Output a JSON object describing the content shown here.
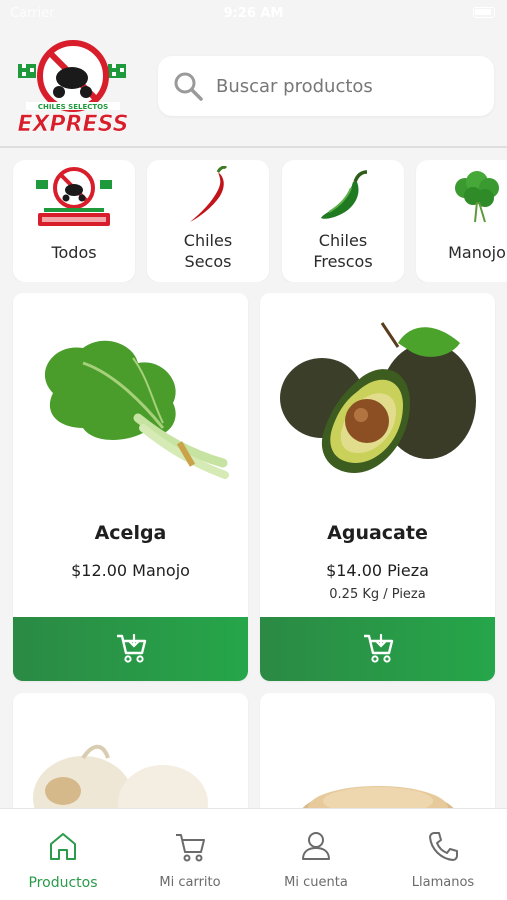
{
  "status_bar": {
    "carrier": "Carrier",
    "time": "9:26 AM"
  },
  "header": {
    "brand_line1": "CHILES SELECTOS",
    "brand_line2": "EXPRESS",
    "search_placeholder": "Buscar productos"
  },
  "categories": [
    {
      "label": "Todos",
      "icon": "brand-logo-icon"
    },
    {
      "label_line1": "Chiles",
      "label_line2": "Secos",
      "icon": "red-chili-icon"
    },
    {
      "label_line1": "Chiles",
      "label_line2": "Frescos",
      "icon": "green-chili-icon"
    },
    {
      "label": "Manojo",
      "icon": "parsley-icon"
    }
  ],
  "products": [
    {
      "name": "Acelga",
      "price": "$12.00 Manojo",
      "icon": "chard-icon"
    },
    {
      "name": "Aguacate",
      "price": "$14.00 Pieza",
      "weight": "0.25 Kg / Pieza",
      "icon": "avocado-icon"
    },
    {
      "icon": "garlic-icon"
    },
    {
      "icon": "sesame-icon"
    }
  ],
  "tabbar": {
    "items": [
      {
        "label": "Productos",
        "icon": "home-icon",
        "active": true
      },
      {
        "label": "Mi carrito",
        "icon": "cart-icon"
      },
      {
        "label": "Mi cuenta",
        "icon": "user-icon"
      },
      {
        "label": "Llamanos",
        "icon": "phone-icon"
      }
    ]
  },
  "colors": {
    "accent_green": "#2b9a4a",
    "brand_red": "#d81e2a",
    "background": "#f4f4f4"
  }
}
